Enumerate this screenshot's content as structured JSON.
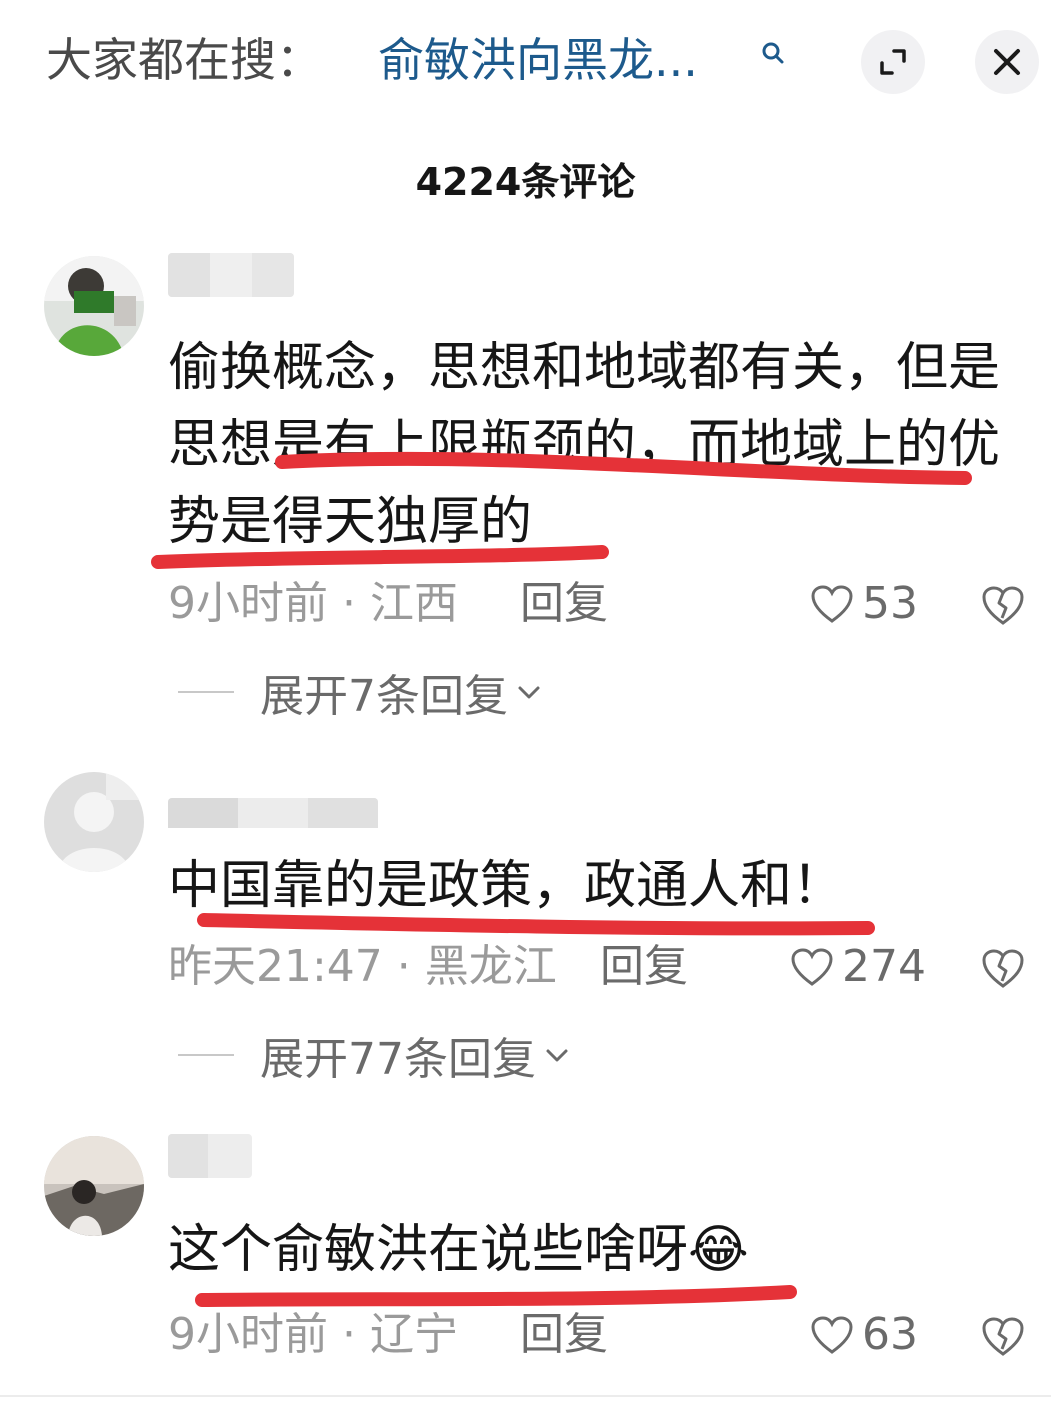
{
  "header": {
    "search_prefix": "大家都在搜：",
    "search_query": "俞敏洪向黑龙...",
    "search_icon": "search-icon",
    "expand_icon": "expand-icon",
    "close_icon": "close-icon"
  },
  "comment_count": "4224条评论",
  "comments": [
    {
      "text": "偷换概念，思想和地域都有关，但是思想是有上限瓶颈的，而地域上的优势是得天独厚的",
      "time_location": "9小时前 · 江西",
      "reply_label": "回复",
      "likes": "53",
      "expand_replies": "展开7条回复"
    },
    {
      "text": "中国靠的是政策，政通人和！",
      "time_location": "昨天21:47 · 黑龙江",
      "reply_label": "回复",
      "likes": "274",
      "expand_replies": "展开77条回复"
    },
    {
      "text": "这个俞敏洪在说些啥呀",
      "emoji": "😂",
      "time_location": "9小时前 · 辽宁",
      "reply_label": "回复",
      "likes": "63"
    }
  ],
  "colors": {
    "accent_link": "#1d5a8c",
    "annotation_red": "#e53238",
    "meta_gray": "#9a9a9a"
  }
}
